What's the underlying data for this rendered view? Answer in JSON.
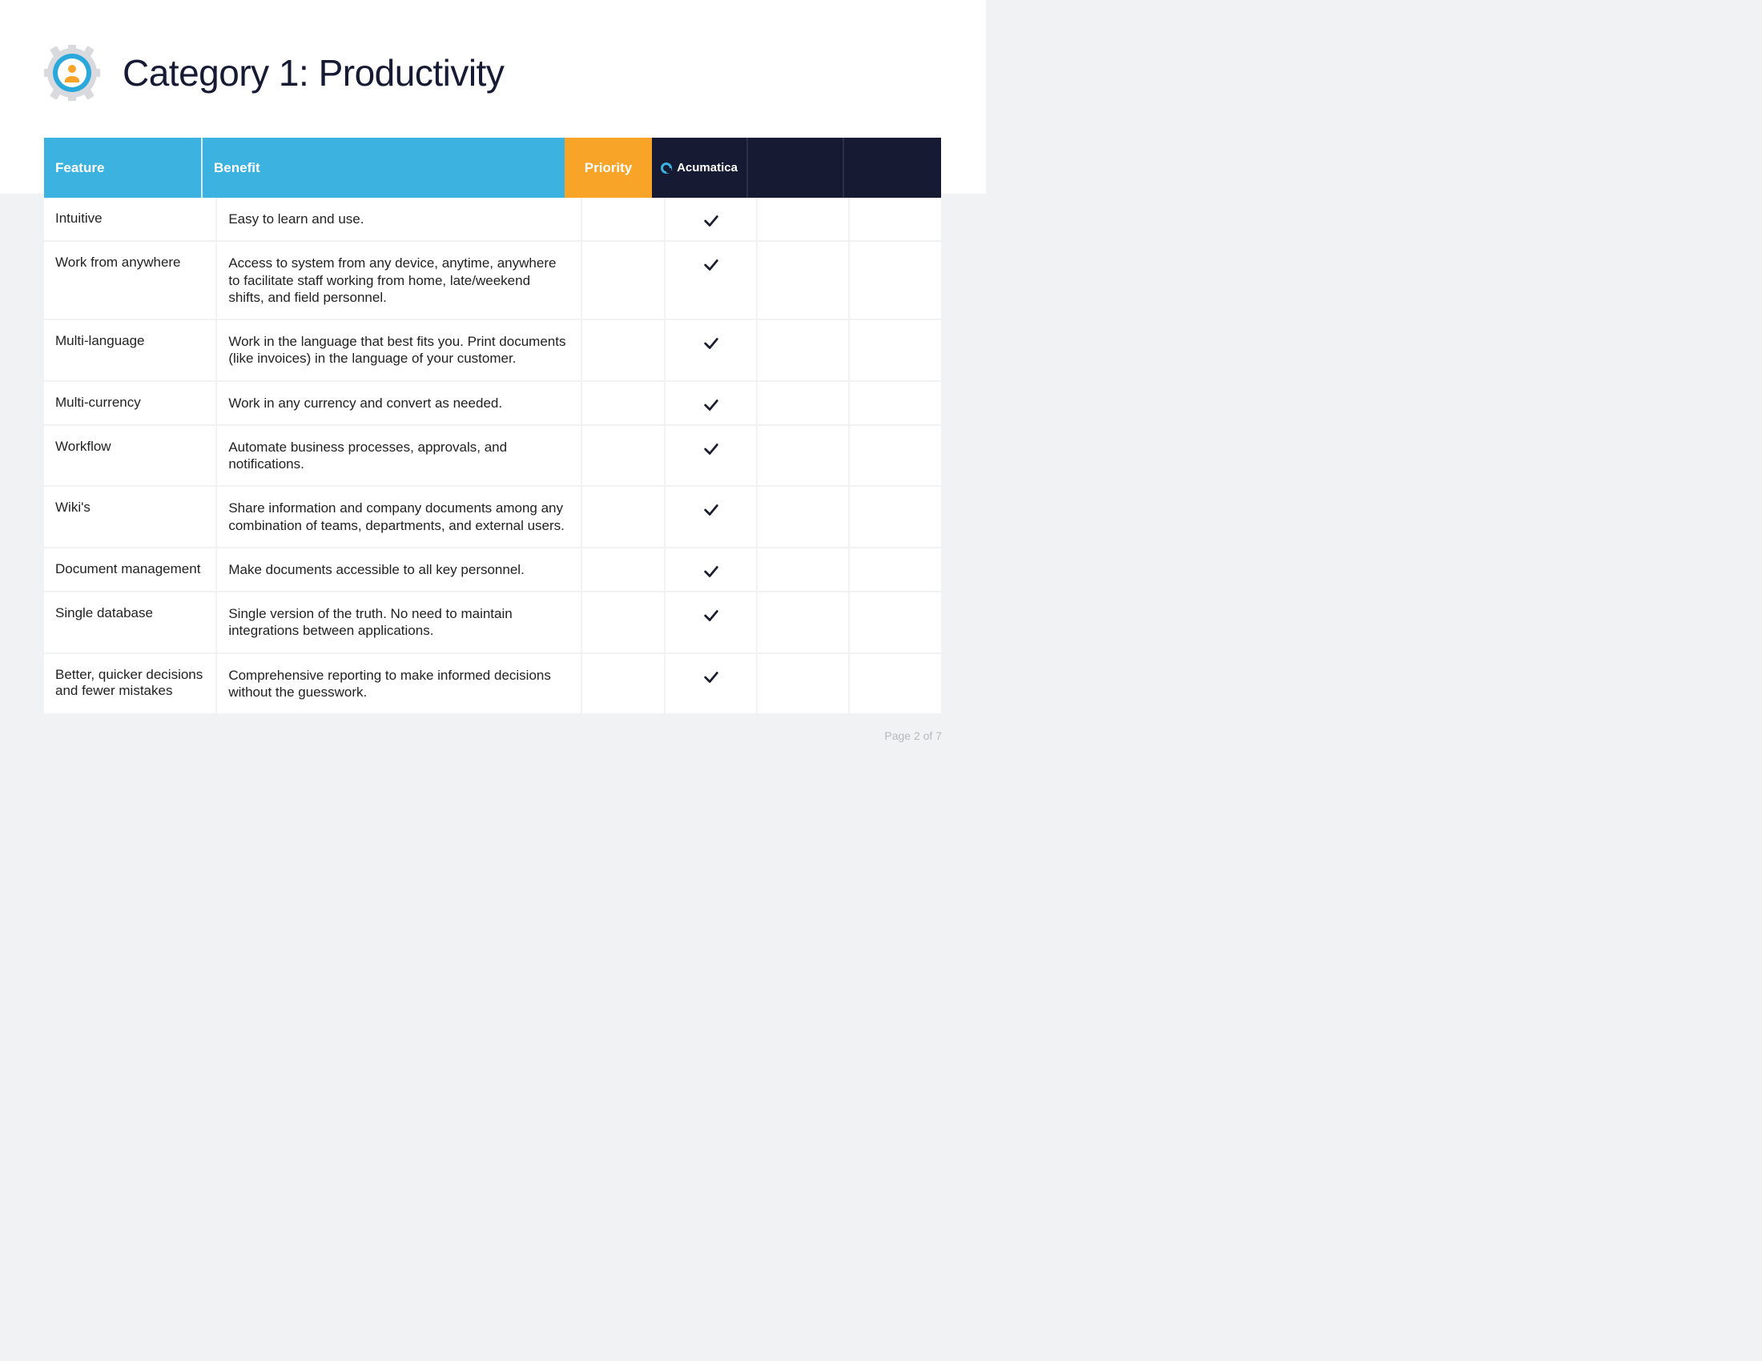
{
  "title": "Category 1: Productivity",
  "columns": {
    "feature": "Feature",
    "benefit": "Benefit",
    "priority": "Priority",
    "vendor": "Acumatica"
  },
  "rows": [
    {
      "feature": "Intuitive",
      "benefit": "Easy to learn and use.",
      "acumatica": true
    },
    {
      "feature": "Work from anywhere",
      "benefit": "Access to system from any device, anytime, anywhere to facilitate staff working from home, late/weekend shifts, and field personnel.",
      "acumatica": true
    },
    {
      "feature": "Multi-language",
      "benefit": "Work in the language that best fits you. Print documents (like invoices) in the language of your customer.",
      "acumatica": true
    },
    {
      "feature": "Multi-currency",
      "benefit": "Work in any currency and convert as needed.",
      "acumatica": true
    },
    {
      "feature": "Workflow",
      "benefit": "Automate business processes, approvals, and notifications.",
      "acumatica": true
    },
    {
      "feature": "Wiki's",
      "benefit": "Share information and company documents among any combination of teams, departments, and external users.",
      "acumatica": true
    },
    {
      "feature": "Document management",
      "benefit": "Make documents accessible to all key personnel.",
      "acumatica": true
    },
    {
      "feature": "Single database",
      "benefit": "Single version of the truth. No need to maintain integrations between applications.",
      "acumatica": true
    },
    {
      "feature": "Better, quicker decisions and fewer mistakes",
      "benefit": "Comprehensive reporting to make informed decisions without the guesswork.",
      "acumatica": true
    }
  ],
  "page_label": "Page 2 of 7",
  "colors": {
    "header_blue": "#3bb2e0",
    "header_orange": "#f7a428",
    "header_dark": "#161a33"
  }
}
